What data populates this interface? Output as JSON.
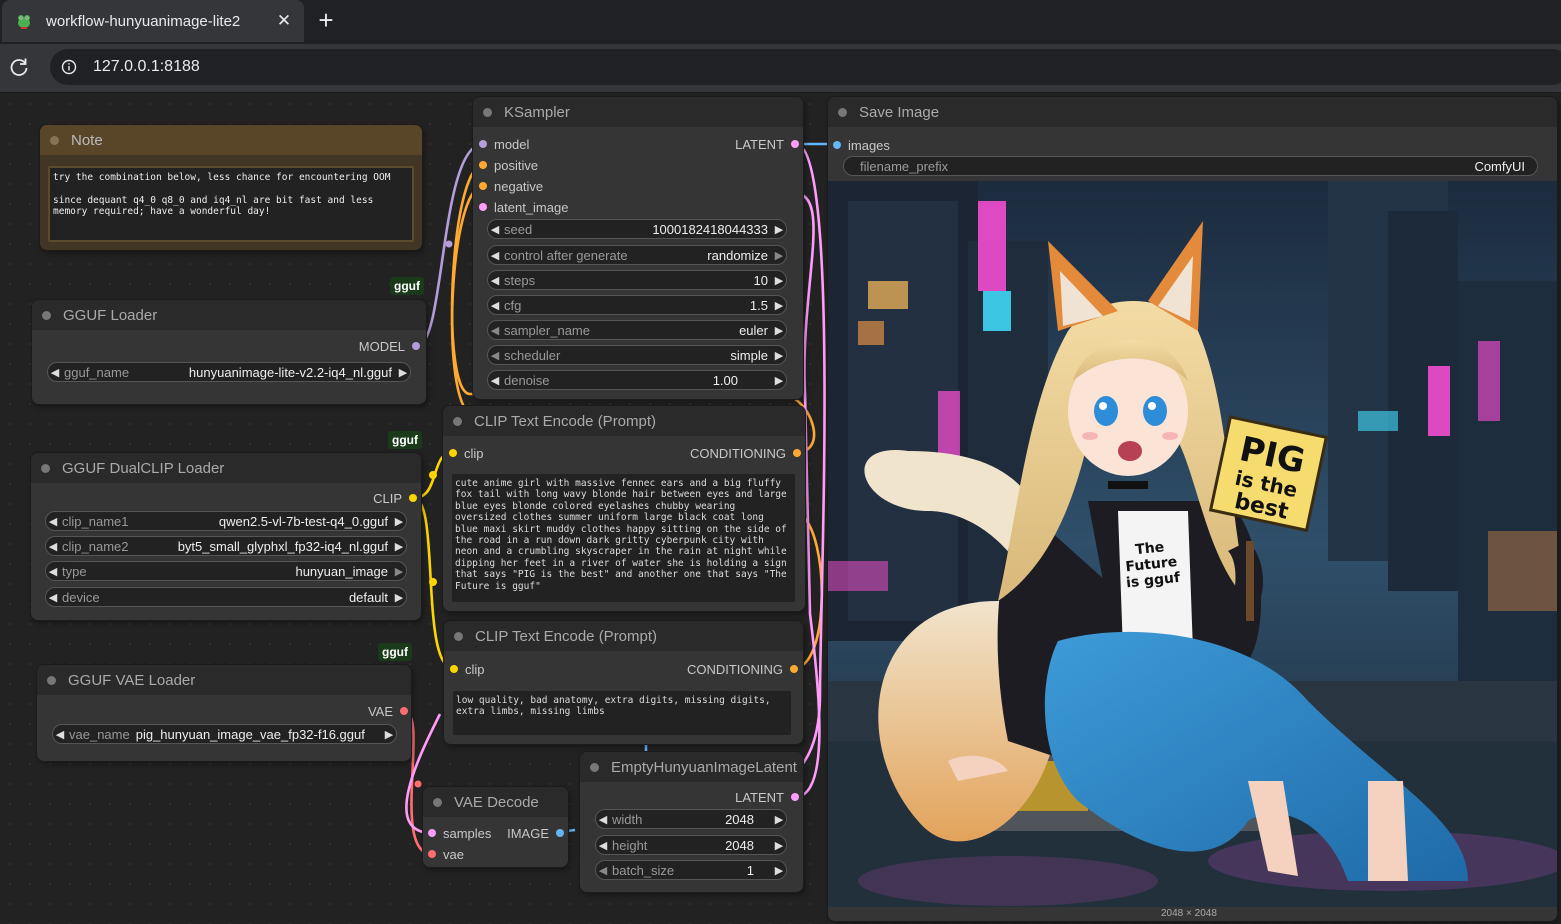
{
  "browser": {
    "tab_title": "workflow-hunyuanimage-lite2",
    "close_glyph": "✕",
    "new_tab_glyph": "+",
    "url": "127.0.0.1:8188"
  },
  "nodes": {
    "note": {
      "title": "Note",
      "text": "try the combination below, less chance for encountering OOM\n\nsince dequant q4_0 q8_0 and iq4_nl are bit fast and less\nmemory required; have a wonderful day!"
    },
    "gguf_loader": {
      "title": "GGUF Loader",
      "tag": "gguf",
      "output": "MODEL",
      "gguf_name_label": "gguf_name",
      "gguf_name": "hunyuanimage-lite-v2.2-iq4_nl.gguf"
    },
    "dualclip": {
      "title": "GGUF DualCLIP Loader",
      "tag": "gguf",
      "output": "CLIP",
      "clip_name1_label": "clip_name1",
      "clip_name1": "qwen2.5-vl-7b-test-q4_0.gguf",
      "clip_name2_label": "clip_name2",
      "clip_name2": "byt5_small_glyphxl_fp32-iq4_nl.gguf",
      "type_label": "type",
      "type": "hunyuan_image",
      "device_label": "device",
      "device": "default"
    },
    "vae_loader": {
      "title": "GGUF VAE Loader",
      "tag": "gguf",
      "output": "VAE",
      "vae_name_label": "vae_name",
      "vae_name": "pig_hunyuan_image_vae_fp32-f16.gguf"
    },
    "ksampler": {
      "title": "KSampler",
      "inputs": [
        "model",
        "positive",
        "negative",
        "latent_image"
      ],
      "output": "LATENT",
      "seed_label": "seed",
      "seed": "1000182418044333",
      "control_label": "control after generate",
      "control": "randomize",
      "steps_label": "steps",
      "steps": "10",
      "cfg_label": "cfg",
      "cfg": "1.5",
      "sampler_label": "sampler_name",
      "sampler": "euler",
      "scheduler_label": "scheduler",
      "scheduler": "simple",
      "denoise_label": "denoise",
      "denoise": "1.00"
    },
    "clip_pos": {
      "title": "CLIP Text Encode (Prompt)",
      "input": "clip",
      "output": "CONDITIONING",
      "text": "cute anime girl with massive fennec ears and a big fluffy fox tail with long wavy blonde hair between eyes and large blue eyes blonde colored eyelashes chubby wearing oversized clothes summer uniform large black coat long blue maxi skirt muddy clothes happy sitting on the side of the road in a run down dark gritty cyberpunk city with neon and a crumbling skyscraper in the rain at night while dipping her feet in a river of water she is holding a sign that says \"PIG is the best\" and another one that says \"The Future is gguf\""
    },
    "clip_neg": {
      "title": "CLIP Text Encode (Prompt)",
      "input": "clip",
      "output": "CONDITIONING",
      "text": "low quality, bad anatomy, extra digits, missing digits, extra limbs, missing limbs"
    },
    "latent": {
      "title": "EmptyHunyuanImageLatent",
      "output": "LATENT",
      "width_label": "width",
      "width": "2048",
      "height_label": "height",
      "height": "2048",
      "batch_label": "batch_size",
      "batch": "1"
    },
    "vae_decode": {
      "title": "VAE Decode",
      "input_samples": "samples",
      "input_vae": "vae",
      "output": "IMAGE"
    },
    "save_image": {
      "title": "Save Image",
      "input": "images",
      "prefix_label": "filename_prefix",
      "prefix": "ComfyUI",
      "sign_text_1": "PIG",
      "sign_text_2": "is the",
      "sign_text_3": "best",
      "shirt_text_1": "The",
      "shirt_text_2": "Future",
      "shirt_text_3": "is gguf",
      "size_caption": "2048 × 2048"
    }
  },
  "colors": {
    "model": "#b39ddb",
    "conditioning": "#ffa931",
    "latent": "#ff9cf9",
    "clip": "#ffd500",
    "vae": "#ff6e6e",
    "image": "#64b5f6"
  }
}
